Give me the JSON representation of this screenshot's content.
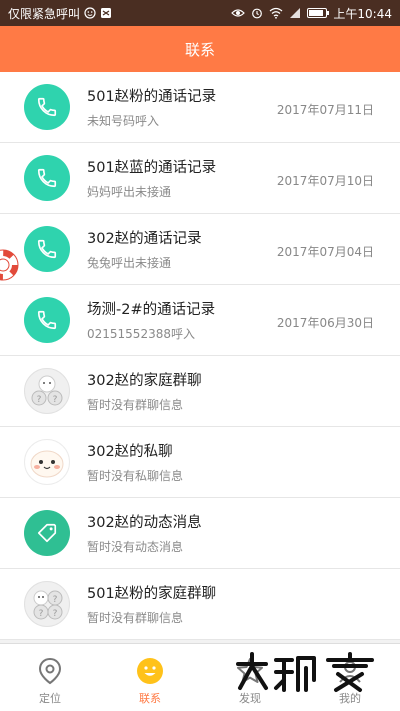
{
  "statusbar": {
    "left_text": "仅限紧急呼叫",
    "time": "上午10:44"
  },
  "header": {
    "title": "联系"
  },
  "list": [
    {
      "type": "phone",
      "title": "501赵粉的通话记录",
      "subtitle": "未知号码呼入",
      "date": "2017年07月11日"
    },
    {
      "type": "phone",
      "title": "501赵蓝的通话记录",
      "subtitle": "妈妈呼出未接通",
      "date": "2017年07月10日"
    },
    {
      "type": "phone",
      "title": "302赵的通话记录",
      "subtitle": "兔兔呼出未接通",
      "date": "2017年07月04日"
    },
    {
      "type": "phone",
      "title": "场测-2#的通话记录",
      "subtitle": "02151552388呼入",
      "date": "2017年06月30日"
    },
    {
      "type": "group",
      "title": "302赵的家庭群聊",
      "subtitle": "暂时没有群聊信息",
      "date": ""
    },
    {
      "type": "face",
      "title": "302赵的私聊",
      "subtitle": "暂时没有私聊信息",
      "date": ""
    },
    {
      "type": "tag",
      "title": "302赵的动态消息",
      "subtitle": "暂时没有动态消息",
      "date": ""
    },
    {
      "type": "group",
      "title": "501赵粉的家庭群聊",
      "subtitle": "暂时没有群聊信息",
      "date": ""
    }
  ],
  "tabs": [
    {
      "label": "定位",
      "icon": "location-pin-icon",
      "active": false
    },
    {
      "label": "联系",
      "icon": "smiley-icon",
      "active": true
    },
    {
      "label": "发现",
      "icon": "star-icon",
      "active": false
    },
    {
      "label": "我的",
      "icon": "profile-icon",
      "active": false
    }
  ],
  "colors": {
    "accent": "#ff7a45",
    "statusbar": "#4a2e22",
    "phone_avatar": "#2fd3ae",
    "tag_avatar": "#2fbf93"
  }
}
